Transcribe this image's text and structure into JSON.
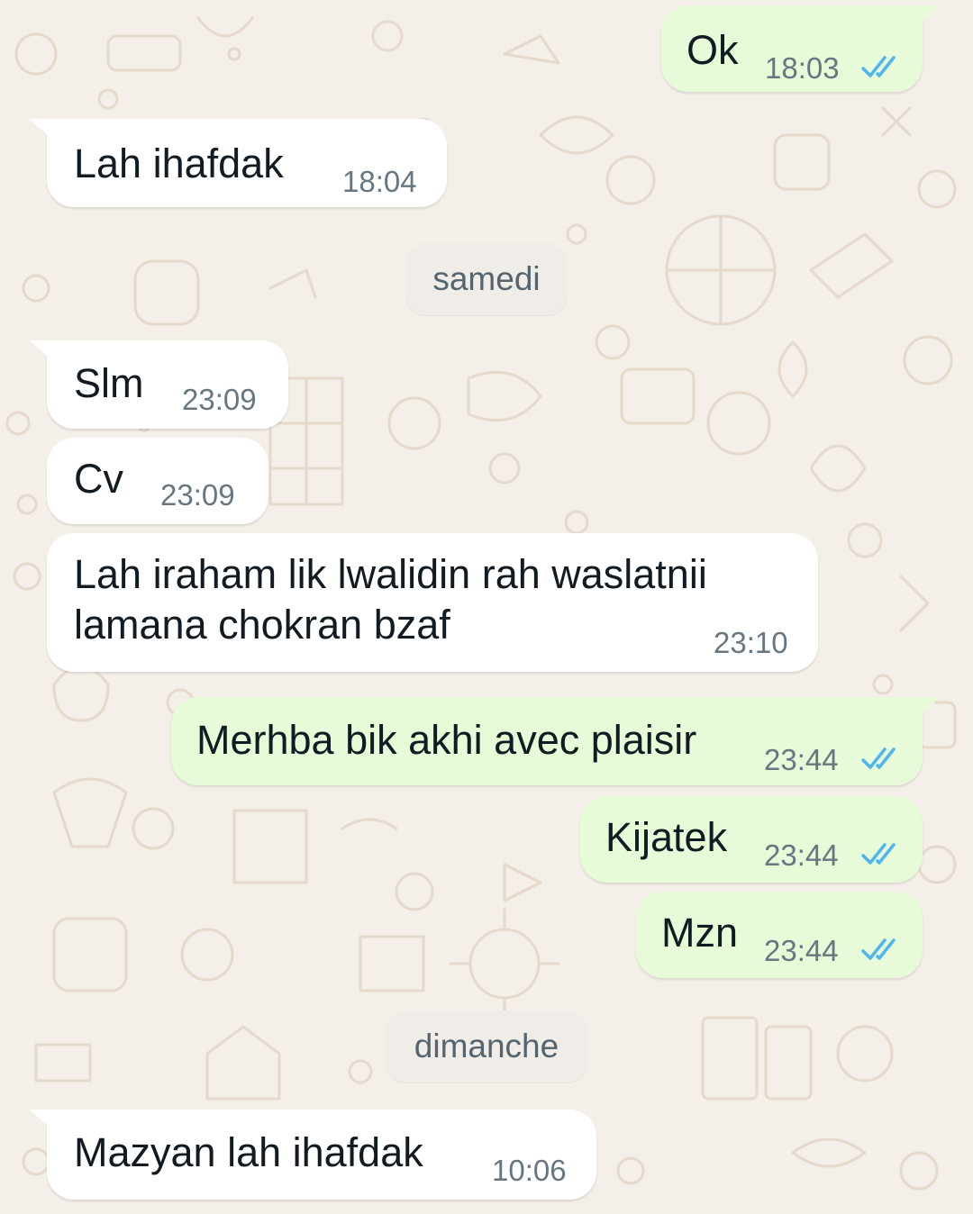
{
  "colors": {
    "incoming_bubble": "#ffffff",
    "outgoing_bubble": "#e7fbd9",
    "wallpaper": "#f4efe8",
    "read_ticks": "#4fb6ec",
    "time_text": "#667781"
  },
  "messages": [
    {
      "dir": "out",
      "text": "Ok",
      "time": "18:03",
      "status": "read",
      "status_icon": "double-check-icon"
    },
    {
      "dir": "in",
      "text": "Lah ihafdak",
      "time": "18:04"
    },
    {
      "dir": "in",
      "text": "Slm",
      "time": "23:09"
    },
    {
      "dir": "in",
      "text": "Cv",
      "time": "23:09"
    },
    {
      "dir": "in",
      "text_lines": [
        "Lah iraham lik lwalidin rah waslatnii",
        "lamana chokran bzaf"
      ],
      "time": "23:10"
    },
    {
      "dir": "out",
      "text": "Merhba bik akhi avec plaisir",
      "time": "23:44",
      "status": "read",
      "status_icon": "double-check-icon"
    },
    {
      "dir": "out",
      "text": "Kijatek",
      "time": "23:44",
      "status": "read",
      "status_icon": "double-check-icon"
    },
    {
      "dir": "out",
      "text": "Mzn",
      "time": "23:44",
      "status": "read",
      "status_icon": "double-check-icon"
    },
    {
      "dir": "in",
      "text": "Mazyan lah ihafdak",
      "time": "10:06"
    }
  ],
  "day_separators": [
    "samedi",
    "dimanche"
  ]
}
